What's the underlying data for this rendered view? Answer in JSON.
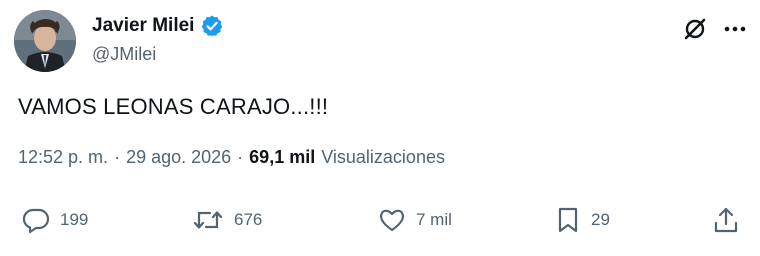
{
  "author": {
    "display_name": "Javier Milei",
    "handle": "@JMilei",
    "verified": true
  },
  "tweet": {
    "text": "VAMOS LEONAS CARAJO...!!!",
    "time": "12:52 p. m.",
    "separator": "·",
    "date": "29 ago. 2026",
    "views_count": "69,1 mil",
    "views_label": "Visualizaciones"
  },
  "actions": {
    "replies": "199",
    "retweets": "676",
    "likes": "7 mil",
    "bookmarks": "29"
  },
  "icons": {
    "top": [
      "grok-icon",
      "more-icon"
    ],
    "actions": [
      "reply-icon",
      "retweet-icon",
      "like-icon",
      "bookmark-icon",
      "share-icon"
    ]
  },
  "colors": {
    "text": "#0f1419",
    "secondary": "#536471",
    "verified": "#1d9bf0"
  }
}
